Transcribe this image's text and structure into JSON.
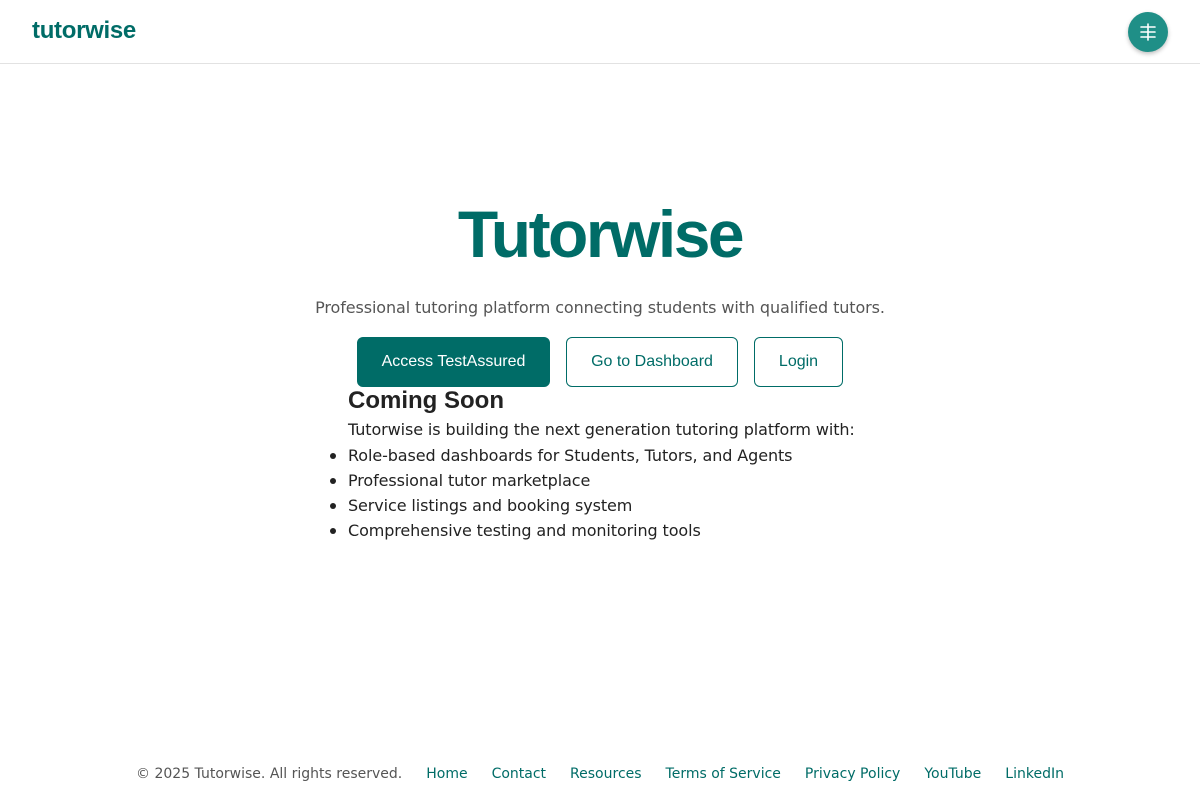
{
  "header": {
    "logo": "tutorwise",
    "menu_icon": "menu-icon"
  },
  "hero": {
    "title": "Tutorwise",
    "subtitle": "Professional tutoring platform connecting students with qualified tutors."
  },
  "actions": {
    "primary_label": "Access TestAssured",
    "dashboard_label": "Go to Dashboard",
    "login_label": "Login"
  },
  "coming_soon": {
    "title": "Coming Soon",
    "description": "Tutorwise is building the next generation tutoring platform with:",
    "features": [
      "Role-based dashboards for Students, Tutors, and Agents",
      "Professional tutor marketplace",
      "Service listings and booking system",
      "Comprehensive testing and monitoring tools"
    ]
  },
  "footer": {
    "copyright": "© 2025 Tutorwise. All rights reserved.",
    "links": [
      "Home",
      "Contact",
      "Resources",
      "Terms of Service",
      "Privacy Policy",
      "YouTube",
      "LinkedIn"
    ]
  },
  "colors": {
    "brand": "#006c67",
    "menu_button": "#1f8f87",
    "text": "#222222",
    "muted_text": "#555555"
  }
}
